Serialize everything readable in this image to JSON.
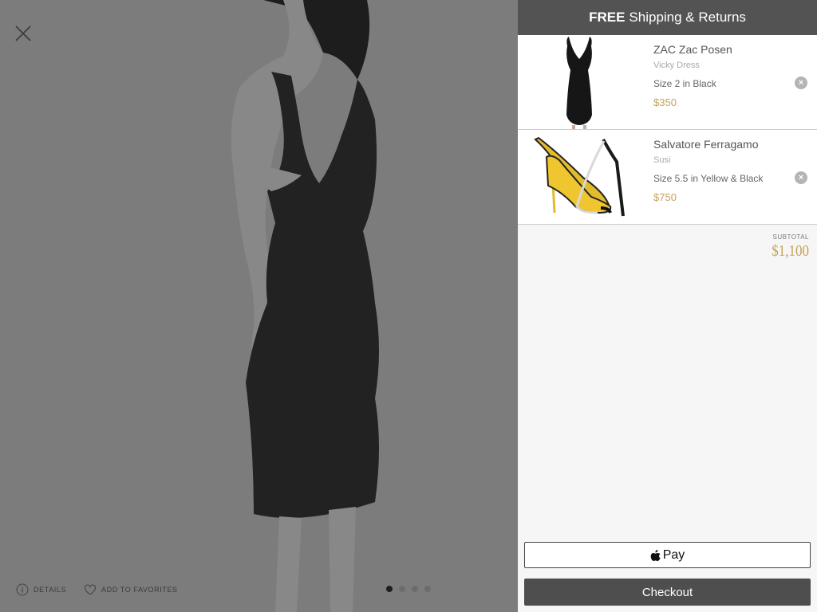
{
  "product_view": {
    "close_icon": "close-icon",
    "details_label": "DETAILS",
    "favorites_label": "ADD TO FAVORITES",
    "image_dots": [
      true,
      false,
      false,
      false
    ]
  },
  "cart": {
    "header_bold": "FREE",
    "header_rest": "Shipping & Returns",
    "items": [
      {
        "brand": "ZAC Zac Posen",
        "name": "Vicky Dress",
        "size": "Size 2 in Black",
        "price": "$350"
      },
      {
        "brand": "Salvatore Ferragamo",
        "name": "Susi",
        "size": "Size 5.5 in Yellow & Black",
        "price": "$750"
      }
    ],
    "subtotal_label": "SUBTOTAL",
    "subtotal_value": "$1,100",
    "applepay_label": "Pay",
    "checkout_label": "Checkout"
  },
  "colors": {
    "accent_price": "#c4a25a",
    "header_bg": "#535353",
    "checkout_bg": "#4e4e4e"
  }
}
